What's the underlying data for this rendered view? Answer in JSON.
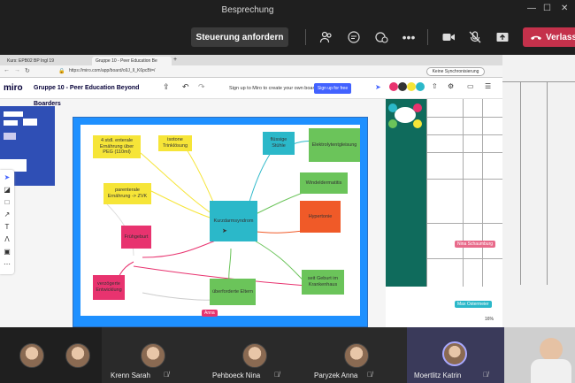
{
  "teams": {
    "meeting_title": "Besprechung",
    "control_button": "Steuerung anfordern",
    "leave_button": "Verlass",
    "icons": [
      "people-icon",
      "chat-icon",
      "reactions-icon",
      "more-icon",
      "camera-icon",
      "mic-off-icon",
      "share-icon",
      "phone-hangup-icon"
    ]
  },
  "browser": {
    "tabs": [
      {
        "label": "Kurs: EPB02 BP Ingl 19"
      },
      {
        "label": "Gruppe 10 - Peer Education Be"
      }
    ],
    "new_tab": "+",
    "address": "https://miro.com/app/board/o9J_lI_K6pcBt=/",
    "sync_button": "Keine Synchronisierung"
  },
  "miro": {
    "logo": "miro",
    "board_name": "Gruppe 10 - Peer Education Beyond Boarders",
    "signup_text": "Sign up to Miro to create your own boards.",
    "signup_button": "Sign up for free",
    "notes": [
      {
        "text": "4 stdl. enterale Ernährung über PEG (110ml)",
        "color": "#f6e538"
      },
      {
        "text": "isotone Trinklösung",
        "color": "#f6e538"
      },
      {
        "text": "flüssige Stühle",
        "color": "#2bb8c9"
      },
      {
        "text": "Elektrolytentgleisung",
        "color": "#6bc45a"
      },
      {
        "text": "Windeldermatitis",
        "color": "#6bc45a"
      },
      {
        "text": "parenterale Ernährung -> ZVK",
        "color": "#f6e538"
      },
      {
        "text": "Kurzdarmsyndrom",
        "color": "#2bb8c9"
      },
      {
        "text": "Hypertonie",
        "color": "#f05a28"
      },
      {
        "text": "Frühgeburt",
        "color": "#e8336f"
      },
      {
        "text": "verzögerte Entwicklung",
        "color": "#e8336f"
      },
      {
        "text": "überforderte Eltern",
        "color": "#6bc45a"
      },
      {
        "text": "seit Geburt im Krankenhaus",
        "color": "#6bc45a"
      }
    ],
    "cursor_tags": [
      {
        "label": "Anna",
        "color": "#e8336f"
      },
      {
        "label": "Nina Schaumburg",
        "color": "#e86a8a"
      },
      {
        "label": "Max Ostermeier",
        "color": "#2bb8c9"
      }
    ],
    "zoom": "16%"
  },
  "participants": [
    {
      "name": ""
    },
    {
      "name": ""
    },
    {
      "name": "Krenn Sarah"
    },
    {
      "name": "Pehboeck Nina"
    },
    {
      "name": "Paryzek Anna"
    },
    {
      "name": "Moertlitz Katrin"
    },
    {
      "name": ""
    }
  ]
}
